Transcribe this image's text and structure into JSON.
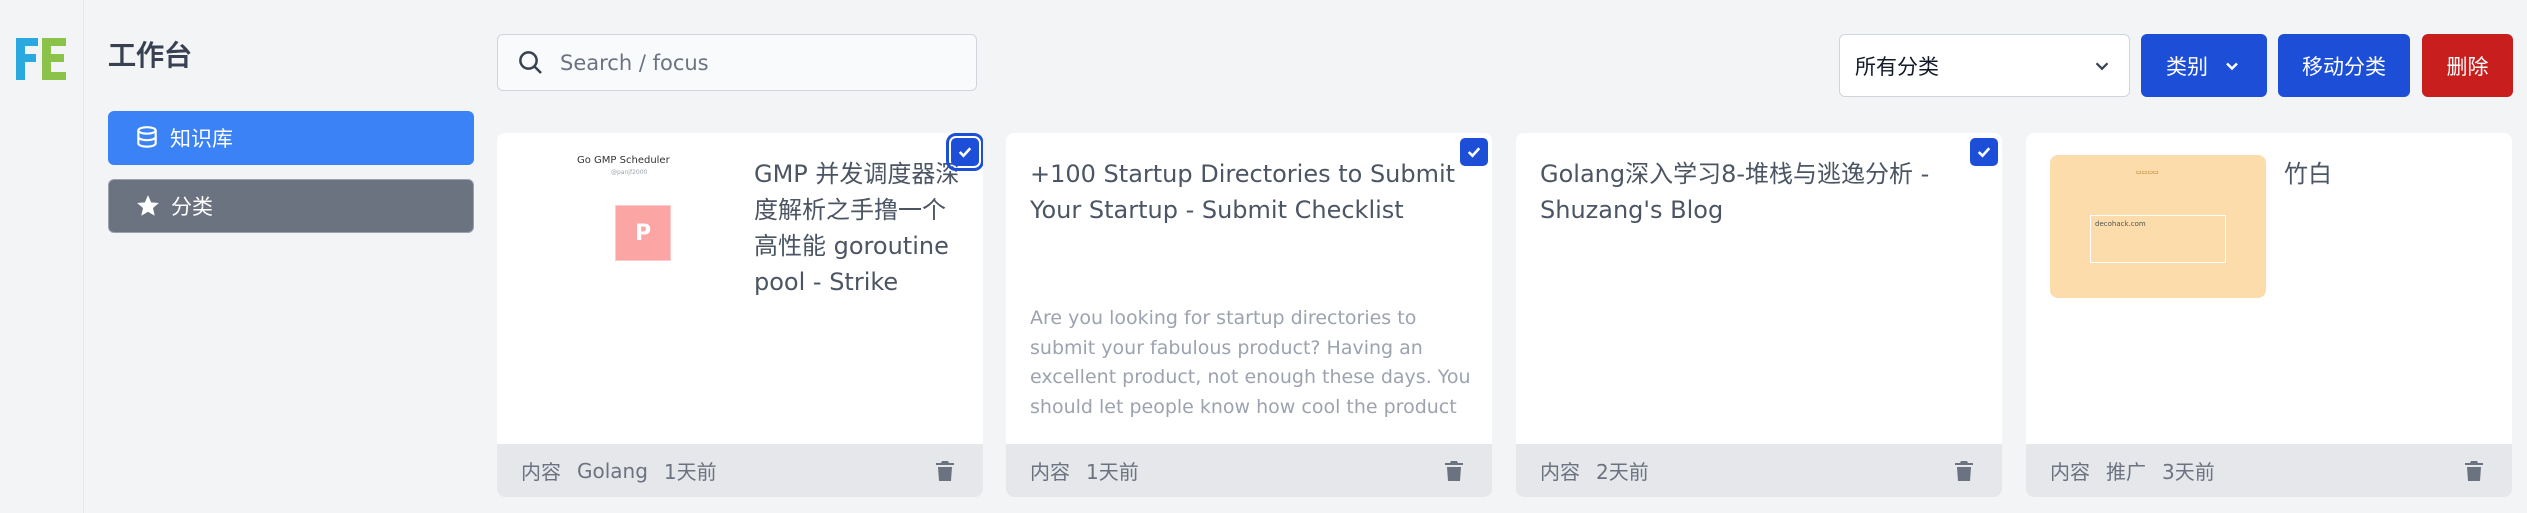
{
  "app": {
    "logo_text": "FE"
  },
  "sidebar": {
    "title": "工作台",
    "items": [
      {
        "label": "知识库",
        "active": true
      },
      {
        "label": "分类",
        "active": false
      }
    ]
  },
  "search": {
    "placeholder": "Search / focus",
    "value": ""
  },
  "toolbar": {
    "select_value": "所有分类",
    "type_label": "类别",
    "move_label": "移动分类",
    "delete_label": "删除"
  },
  "cards": [
    {
      "title": "GMP 并发调度器深度解析之手撸一个高性能 goroutine pool - Strike",
      "thumb": {
        "title": "Go GMP Scheduler",
        "subtitle": "@panjf2000",
        "tile": "P"
      },
      "checked": true,
      "footer": [
        "内容",
        "Golang",
        "1天前"
      ]
    },
    {
      "title": "+100 Startup Directories to Submit Your Startup - Submit Checklist",
      "description": "Are you looking for startup directories to submit your fabulous product? Having an excellent product, not enough these days. You should let people know how cool the product",
      "checked": true,
      "footer": [
        "内容",
        "1天前"
      ]
    },
    {
      "title": "Golang深入学习8-堆栈与逃逸分析 - Shuzang's Blog",
      "checked": true,
      "footer": [
        "内容",
        "2天前"
      ]
    },
    {
      "title": "竹白",
      "thumb": {
        "box_text": "decohack.com"
      },
      "checked": false,
      "footer": [
        "内容",
        "推广",
        "3天前"
      ]
    }
  ],
  "colors": {
    "primary": "#1d4ed8",
    "active_nav": "#3b82f6",
    "muted_nav": "#6b7280",
    "danger": "#c81e1e"
  }
}
